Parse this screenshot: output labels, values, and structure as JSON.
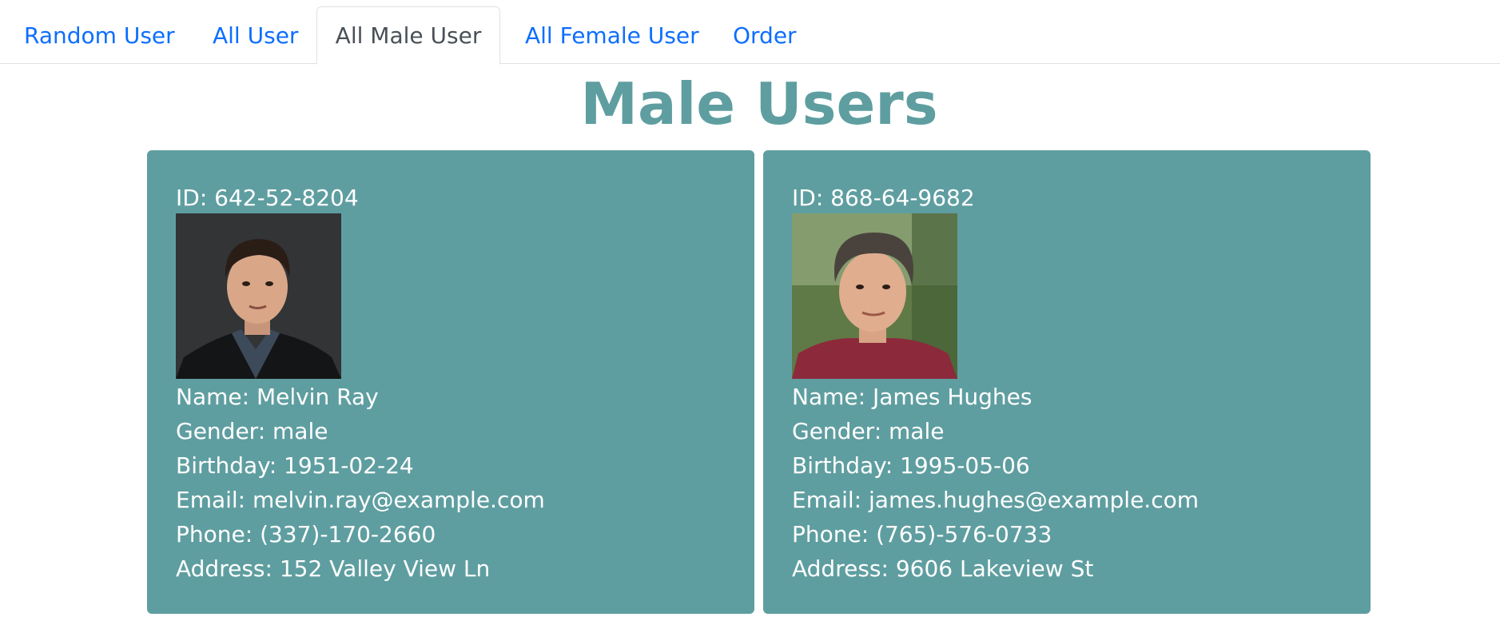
{
  "nav": {
    "tabs": [
      {
        "label": "Random User",
        "active": false
      },
      {
        "label": "All User",
        "active": false
      },
      {
        "label": "All Male User",
        "active": true
      },
      {
        "label": "All Female User",
        "active": false
      },
      {
        "label": "Order",
        "active": false
      }
    ]
  },
  "page": {
    "title": "Male Users"
  },
  "users": [
    {
      "id": "ID: 642-52-8204",
      "name": "Name: Melvin Ray",
      "gender": "Gender: male",
      "birthday": "Birthday: 1951-02-24",
      "email": "Email: melvin.ray@example.com",
      "phone": "Phone: (337)-170-2660",
      "address": "Address: 152 Valley View Ln"
    },
    {
      "id": "ID: 868-64-9682",
      "name": "Name: James Hughes",
      "gender": "Gender: male",
      "birthday": "Birthday: 1995-05-06",
      "email": "Email: james.hughes@example.com",
      "phone": "Phone: (765)-576-0733",
      "address": "Address: 9606 Lakeview St"
    }
  ],
  "colors": {
    "accent": "#5f9ea0",
    "link": "#0d6efd",
    "active_tab_text": "#495057"
  }
}
